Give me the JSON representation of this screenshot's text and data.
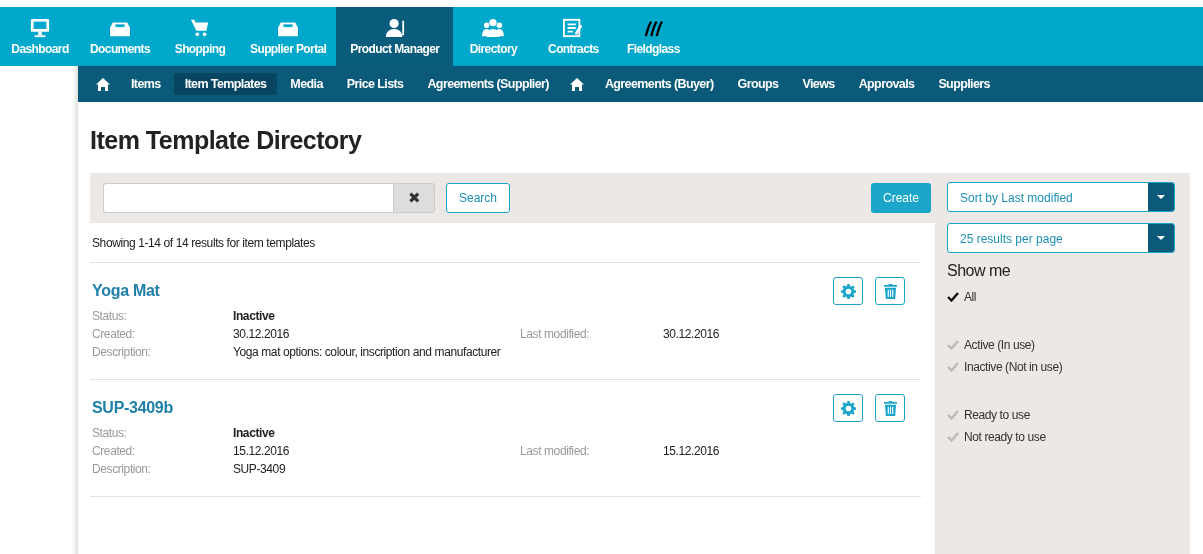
{
  "top_nav": [
    {
      "label": "Dashboard",
      "selected": false
    },
    {
      "label": "Documents",
      "selected": false
    },
    {
      "label": "Shopping",
      "selected": false
    },
    {
      "label": "Supplier Portal",
      "selected": false
    },
    {
      "label": "Product Manager",
      "selected": true
    },
    {
      "label": "Directory",
      "selected": false
    },
    {
      "label": "Contracts",
      "selected": false
    },
    {
      "label": "Fieldglass",
      "selected": false
    }
  ],
  "sub_nav": [
    {
      "kind": "home",
      "selected": false
    },
    {
      "kind": "link",
      "label": "Items",
      "selected": false
    },
    {
      "kind": "link",
      "label": "Item Templates",
      "selected": true
    },
    {
      "kind": "link",
      "label": "Media",
      "selected": false
    },
    {
      "kind": "link",
      "label": "Price Lists",
      "selected": false
    },
    {
      "kind": "link",
      "label": "Agreements (Supplier)",
      "selected": false
    },
    {
      "kind": "home",
      "selected": false
    },
    {
      "kind": "link",
      "label": "Agreements (Buyer)",
      "selected": false
    },
    {
      "kind": "link",
      "label": "Groups",
      "selected": false
    },
    {
      "kind": "link",
      "label": "Views",
      "selected": false
    },
    {
      "kind": "link",
      "label": "Approvals",
      "selected": false
    },
    {
      "kind": "link",
      "label": "Suppliers",
      "selected": false
    }
  ],
  "page_title": "Item Template Directory",
  "toolbar": {
    "clear": "✖",
    "search_button": "Search",
    "create_button": "Create"
  },
  "results_summary": "Showing 1-14 of 14 results for item templates",
  "templates": [
    {
      "name": "Yoga Mat",
      "status_label": "Status:",
      "status": "Inactive",
      "created_label": "Created:",
      "created": "30.12.2016",
      "modified_label": "Last modified:",
      "modified": "30.12.2016",
      "description_label": "Description:",
      "description": "Yoga mat options: colour, inscription and manufacturer"
    },
    {
      "name": "SUP-3409b",
      "status_label": "Status:",
      "status": "Inactive",
      "created_label": "Created:",
      "created": "15.12.2016",
      "modified_label": "Last modified:",
      "modified": "15.12.2016",
      "description_label": "Description:",
      "description": "SUP-3409"
    }
  ],
  "sidebar": {
    "sort": "Sort by Last modified",
    "per_page": "25 results per page",
    "show_me": "Show me",
    "filter_groups": [
      {
        "filters": [
          {
            "label": "All",
            "checked": true
          }
        ]
      },
      {
        "filters": [
          {
            "label": "Active (In use)",
            "checked": false
          },
          {
            "label": "Inactive (Not in use)",
            "checked": false
          }
        ]
      },
      {
        "filters": [
          {
            "label": "Ready to use",
            "checked": false
          },
          {
            "label": "Not ready to use",
            "checked": false
          }
        ]
      }
    ]
  }
}
